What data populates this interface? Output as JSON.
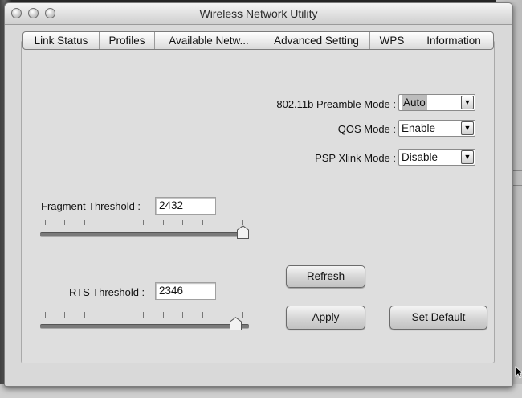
{
  "window": {
    "title": "Wireless Network Utility"
  },
  "tabs": [
    {
      "label": "Link Status"
    },
    {
      "label": "Profiles"
    },
    {
      "label": "Available Netw..."
    },
    {
      "label": "Advanced Setting"
    },
    {
      "label": "WPS"
    },
    {
      "label": "Information"
    }
  ],
  "settings": {
    "preamble": {
      "label": "802.11b  Preamble Mode :",
      "value": "Auto"
    },
    "qos": {
      "label": "QOS Mode :",
      "value": "Enable"
    },
    "psp": {
      "label": "PSP Xlink Mode :",
      "value": "Disable"
    }
  },
  "fragment": {
    "label": "Fragment Threshold :",
    "value": "2432"
  },
  "rts": {
    "label": "RTS Threshold :",
    "value": "2346"
  },
  "buttons": {
    "refresh": "Refresh",
    "apply": "Apply",
    "set_default": "Set Default"
  }
}
